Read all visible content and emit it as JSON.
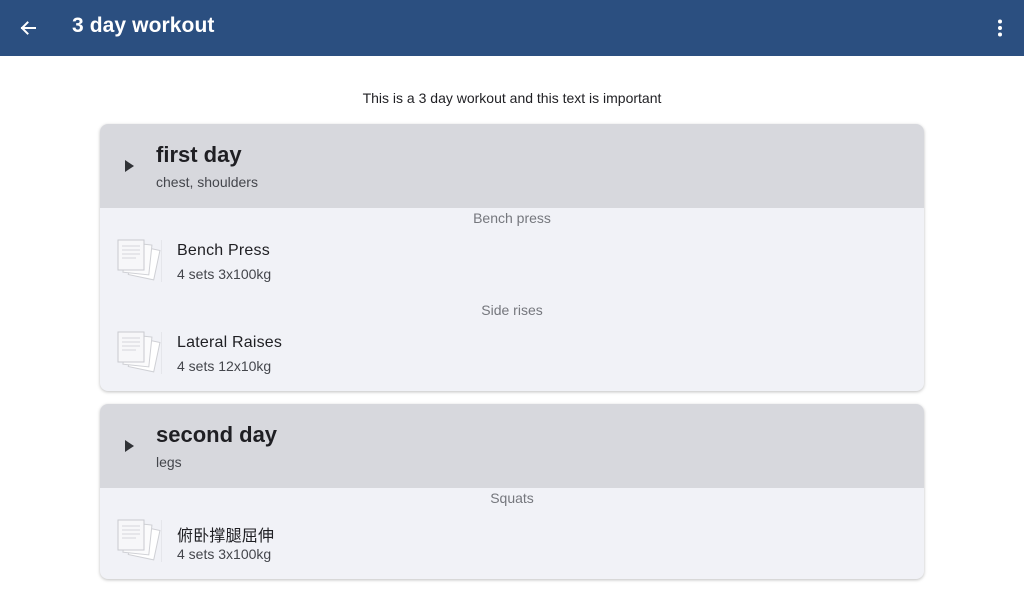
{
  "appbar": {
    "title": "3 day workout",
    "back_icon": "arrow-left-icon",
    "menu_icon": "more-vert-icon",
    "color": "#2b4f80"
  },
  "description": "This is a 3 day workout and this text is important",
  "days": [
    {
      "title": "first day",
      "subtitle": "chest, shoulders",
      "exercises": [
        {
          "label": "Bench press",
          "name": "Bench Press",
          "detail": "4 sets 3x100kg"
        },
        {
          "label": "Side rises",
          "name": "Lateral Raises",
          "detail": "4 sets 12x10kg"
        }
      ]
    },
    {
      "title": "second day",
      "subtitle": "legs",
      "exercises": [
        {
          "label": "Squats",
          "name": "俯卧撑腿屈伸",
          "detail": "4 sets 3x100kg"
        }
      ]
    }
  ]
}
